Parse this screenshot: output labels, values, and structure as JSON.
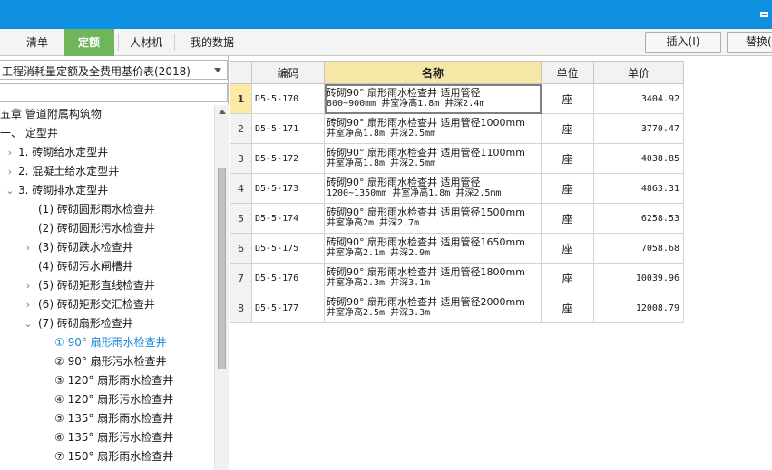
{
  "tabs": [
    {
      "label": "清单",
      "active": false
    },
    {
      "label": "定额",
      "active": true
    },
    {
      "label": "人材机",
      "active": false
    },
    {
      "label": "我的数据",
      "active": false
    }
  ],
  "toolbar": {
    "insert_label": "插入(I)",
    "replace_label": "替换("
  },
  "library_select": {
    "value": "工程消耗量定额及全费用基价表(2018)"
  },
  "search": {
    "value": ""
  },
  "tree": [
    {
      "label": "五章 管道附属构筑物",
      "toggle": "",
      "indent": 0,
      "selected": false
    },
    {
      "label": "一、 定型井",
      "toggle": "",
      "indent": 0,
      "selected": false
    },
    {
      "label": "1. 砖砌给水定型井",
      "toggle": ">",
      "indent": 1,
      "selected": false
    },
    {
      "label": "2. 混凝土给水定型井",
      "toggle": ">",
      "indent": 1,
      "selected": false
    },
    {
      "label": "3. 砖砌排水定型井",
      "toggle": "v",
      "indent": 1,
      "selected": false
    },
    {
      "label": "(1) 砖砌圆形雨水检查井",
      "toggle": "",
      "indent": 2,
      "selected": false
    },
    {
      "label": "(2) 砖砌圆形污水检查井",
      "toggle": "",
      "indent": 2,
      "selected": false
    },
    {
      "label": "(3) 砖砌跌水检查井",
      "toggle": ">",
      "indent": 2,
      "selected": false
    },
    {
      "label": "(4) 砖砌污水闸槽井",
      "toggle": "",
      "indent": 2,
      "selected": false
    },
    {
      "label": "(5) 砖砌矩形直线检查井",
      "toggle": ">",
      "indent": 2,
      "selected": false
    },
    {
      "label": "(6) 砖砌矩形交汇检查井",
      "toggle": ">",
      "indent": 2,
      "selected": false
    },
    {
      "label": "(7) 砖砌扇形检查井",
      "toggle": "v",
      "indent": 2,
      "selected": false
    },
    {
      "label": "① 90° 扇形雨水检查井",
      "toggle": "",
      "indent": 3,
      "selected": true
    },
    {
      "label": "② 90° 扇形污水检查井",
      "toggle": "",
      "indent": 3,
      "selected": false
    },
    {
      "label": "③ 120° 扇形雨水检查井",
      "toggle": "",
      "indent": 3,
      "selected": false
    },
    {
      "label": "④ 120° 扇形污水检查井",
      "toggle": "",
      "indent": 3,
      "selected": false
    },
    {
      "label": "⑤ 135° 扇形雨水检查井",
      "toggle": "",
      "indent": 3,
      "selected": false
    },
    {
      "label": "⑥ 135° 扇形污水检查井",
      "toggle": "",
      "indent": 3,
      "selected": false
    },
    {
      "label": "⑦ 150° 扇形雨水检查井",
      "toggle": "",
      "indent": 3,
      "selected": false
    }
  ],
  "table": {
    "headers": [
      "",
      "编码",
      "名称",
      "单位",
      "单价"
    ],
    "rows": [
      {
        "idx": "1",
        "code": "D5-5-170",
        "name1": "砖砌90° 扇形雨水检查井 适用管径",
        "name2": "800~900mm 井室净高1.8m 井深2.4m",
        "unit": "座",
        "price": "3404.92"
      },
      {
        "idx": "2",
        "code": "D5-5-171",
        "name1": "砖砌90° 扇形雨水检查井 适用管径1000mm",
        "name2": "井室净高1.8m 井深2.5mm",
        "unit": "座",
        "price": "3770.47"
      },
      {
        "idx": "3",
        "code": "D5-5-172",
        "name1": "砖砌90° 扇形雨水检查井 适用管径1100mm",
        "name2": "井室净高1.8m 井深2.5mm",
        "unit": "座",
        "price": "4038.85"
      },
      {
        "idx": "4",
        "code": "D5-5-173",
        "name1": "砖砌90° 扇形雨水检查井 适用管径",
        "name2": "1200~1350mm 井室净高1.8m 井深2.5mm",
        "unit": "座",
        "price": "4863.31"
      },
      {
        "idx": "5",
        "code": "D5-5-174",
        "name1": "砖砌90° 扇形雨水检查井 适用管径1500mm",
        "name2": "井室净高2m 井深2.7m",
        "unit": "座",
        "price": "6258.53"
      },
      {
        "idx": "6",
        "code": "D5-5-175",
        "name1": "砖砌90° 扇形雨水检查井 适用管径1650mm",
        "name2": "井室净高2.1m 井深2.9m",
        "unit": "座",
        "price": "7058.68"
      },
      {
        "idx": "7",
        "code": "D5-5-176",
        "name1": "砖砌90° 扇形雨水检查井 适用管径1800mm",
        "name2": "井室净高2.3m 井深3.1m",
        "unit": "座",
        "price": "10039.96"
      },
      {
        "idx": "8",
        "code": "D5-5-177",
        "name1": "砖砌90° 扇形雨水检查井 适用管径2000mm",
        "name2": "井室净高2.5m 井深3.3m",
        "unit": "座",
        "price": "12008.79"
      }
    ]
  }
}
